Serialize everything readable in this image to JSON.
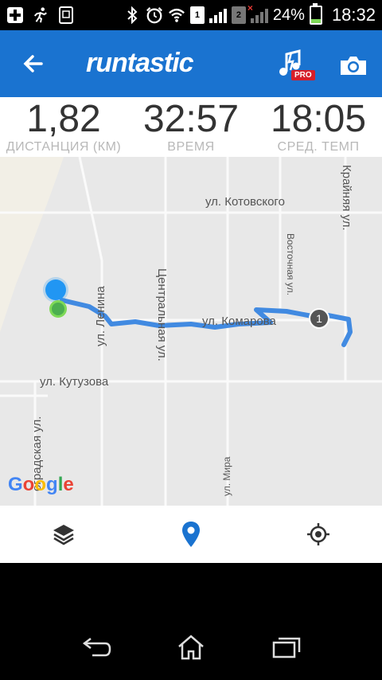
{
  "status_bar": {
    "icons": [
      "add-icon",
      "runner-icon",
      "screenshot-icon",
      "bluetooth-icon",
      "alarm-icon",
      "wifi-icon",
      "sim1-signal-icon",
      "sim2-signal-icon",
      "battery-icon"
    ],
    "sim1_label": "1",
    "sim2_label": "2",
    "battery": "24%",
    "time": "18:32"
  },
  "app_bar": {
    "logo": "runtastic",
    "pro_badge": "PRO"
  },
  "stats": [
    {
      "value": "1,82",
      "label": "ДИСТАНЦИЯ (КМ)"
    },
    {
      "value": "32:57",
      "label": "ВРЕМЯ"
    },
    {
      "value": "18:05",
      "label": "СРЕД. ТЕМП"
    }
  ],
  "map": {
    "streets": {
      "kotovskogo": "ул. Котовского",
      "komarova": "ул. Комарова",
      "kutuzova": "ул. Кутузова",
      "lenina": "ул. Ленина",
      "centralnaya": "Центральная ул.",
      "vostochnaya": "Восточная ул.",
      "krainyaya": "Крайняя ул.",
      "mira": "ул. Мира",
      "gradskaya": "оградская ул."
    },
    "marker_label": "1",
    "attribution": "Google",
    "colors": {
      "route": "#2f7fe0",
      "start": "#4caf50",
      "position": "#2196f3",
      "marker": "#555555"
    }
  },
  "bottom_bar": {
    "icons": [
      "layers-icon",
      "location-pin-icon",
      "my-location-icon"
    ],
    "accent": "#1a73d0"
  },
  "nav_bar": {
    "icons": [
      "back-icon",
      "home-icon",
      "recents-icon"
    ]
  }
}
